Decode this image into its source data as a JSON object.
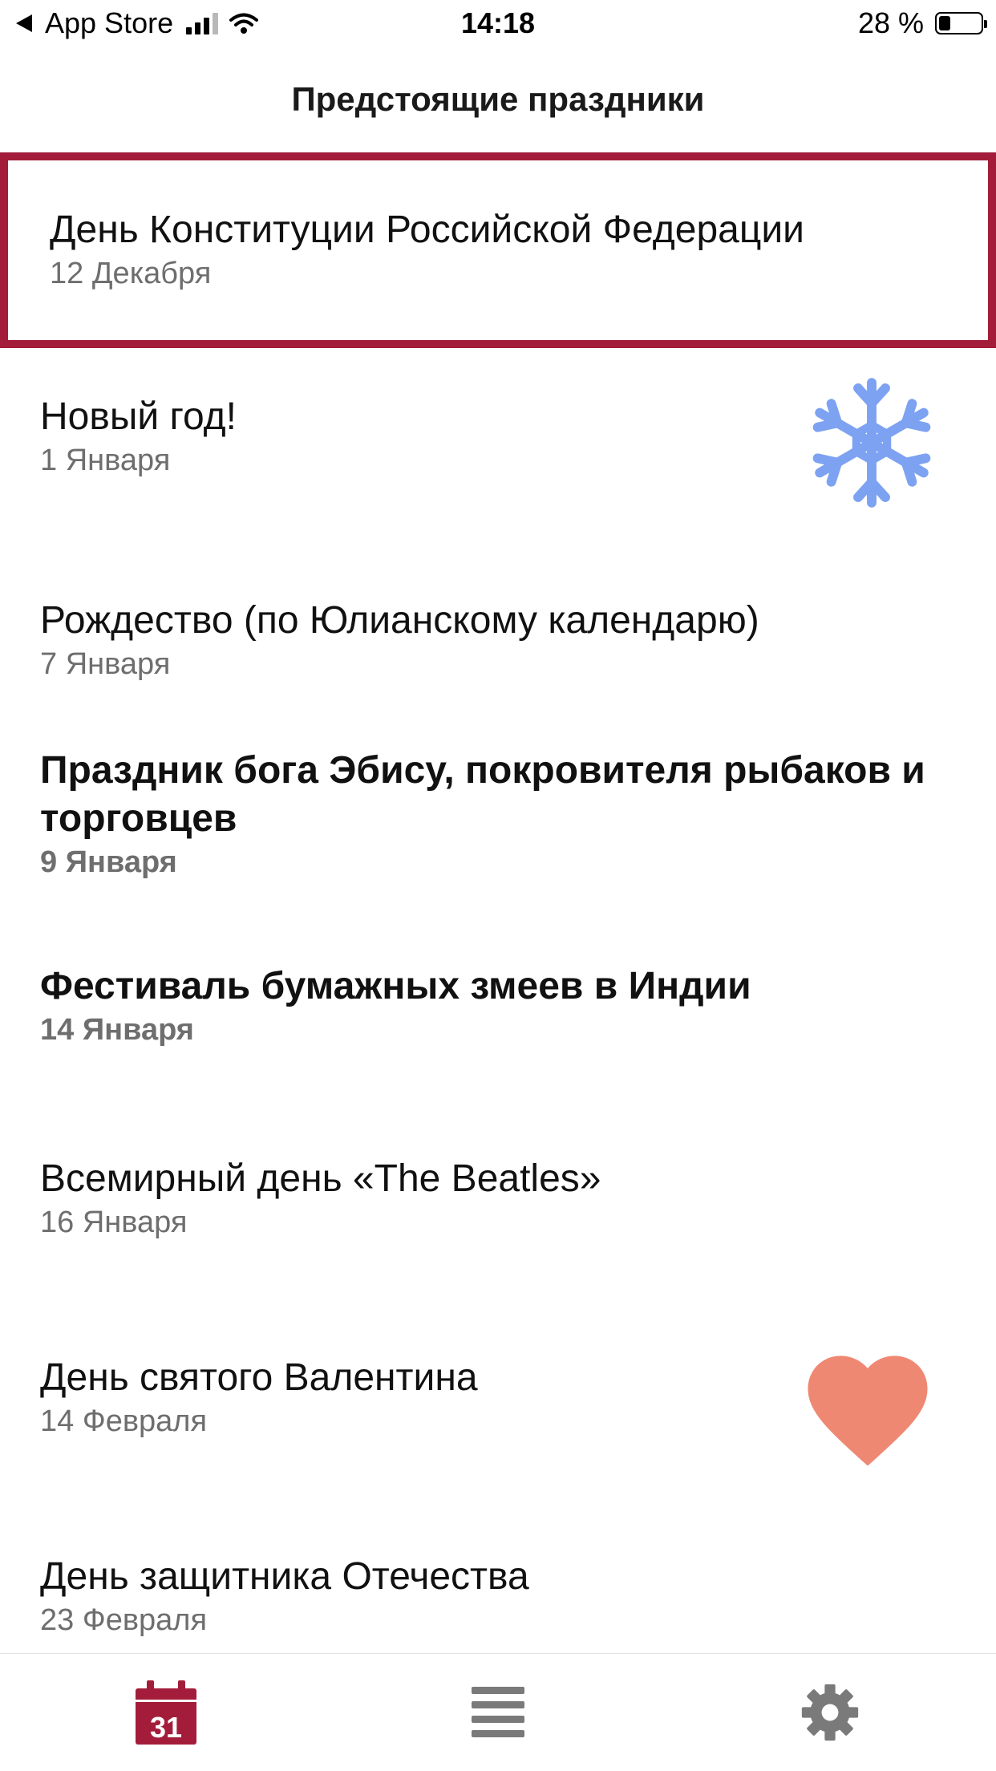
{
  "status_bar": {
    "back_label": "App Store",
    "time": "14:18",
    "battery_text": "28 %",
    "battery_level": 0.28
  },
  "header": {
    "title": "Предстоящие праздники"
  },
  "holidays": [
    {
      "name": "День Конституции Российской Федерации",
      "date": "12 Декабря",
      "highlighted": true,
      "bold": false,
      "icon": ""
    },
    {
      "name": "Новый год!",
      "date": "1 Января",
      "highlighted": false,
      "bold": false,
      "icon": "snowflake-icon"
    },
    {
      "name": "Рождество (по Юлианскому календарю)",
      "date": "7 Января",
      "highlighted": false,
      "bold": false,
      "icon": ""
    },
    {
      "name": "Праздник бога Эбису, покровителя рыбаков и торговцев",
      "date": "9 Января",
      "highlighted": false,
      "bold": true,
      "icon": ""
    },
    {
      "name": "Фестиваль бумажных змеев в Индии",
      "date": "14 Января",
      "highlighted": false,
      "bold": true,
      "icon": ""
    },
    {
      "name": "Всемирный день «The Beatles»",
      "date": "16 Января",
      "highlighted": false,
      "bold": false,
      "icon": ""
    },
    {
      "name": "День святого Валентина",
      "date": "14 Февраля",
      "highlighted": false,
      "bold": false,
      "icon": "heart-icon"
    },
    {
      "name": "День защитника Отечества",
      "date": "23 Февраля",
      "highlighted": false,
      "bold": false,
      "icon": ""
    }
  ],
  "colors": {
    "accent": "#a31d3a",
    "snowflake": "#7da2f1",
    "heart": "#ef8872",
    "date_text": "#6e6e6e",
    "tab_icon_inactive": "#7a7a7a"
  },
  "tab_bar": {
    "calendar_day": "31",
    "tabs": [
      "calendar-icon",
      "list-icon",
      "gear-icon"
    ],
    "active_tab": "calendar-icon"
  }
}
